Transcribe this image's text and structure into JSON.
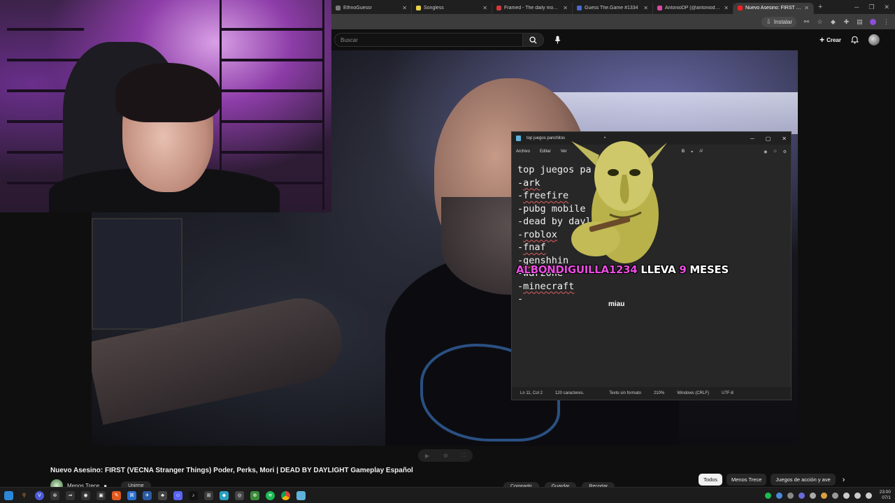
{
  "browser": {
    "tabs": [
      {
        "label": "EthnoGuessr",
        "color": "#7a7a7a",
        "active": false
      },
      {
        "label": "Songless",
        "color": "#e8d14a",
        "active": false
      },
      {
        "label": "Framed - The daily movie gu",
        "color": "#d03a3a",
        "active": false
      },
      {
        "label": "Guess The.Game #1334",
        "color": "#4a6ad0",
        "active": false
      },
      {
        "label": "AntonioDP (@antoniodesanti",
        "color": "#d94aa0",
        "active": false
      },
      {
        "label": "Nuevo Asesino: FIRST (VECNA",
        "color": "#ff2020",
        "active": true
      }
    ],
    "install_label": "Instalar"
  },
  "youtube": {
    "search_placeholder": "Buscar",
    "create_label": "Crear",
    "video_title": "Nuevo Asesino: FIRST (VECNA Stranger Things) Poder, Perks, Mori | DEAD BY DAYLIGHT Gameplay Español",
    "channel_name": "Menos Trece",
    "join_label": "Unirme",
    "chips": [
      "Todos",
      "Menos Trece",
      "Juegos de acción y ave"
    ],
    "action_labels": [
      "Compartir",
      "Guardar",
      "Recortar"
    ]
  },
  "notepad": {
    "tab_title": "top juegos panchitos",
    "menu": [
      "Archivo",
      "Editar",
      "Ver"
    ],
    "lines": [
      {
        "text": "top juegos pa",
        "underline": false
      },
      {
        "text": "-ark",
        "underline": true
      },
      {
        "text": "-freefire",
        "underline": true
      },
      {
        "text": "-pubg mobile",
        "underline": false
      },
      {
        "text": "-dead by dayli",
        "underline": false
      },
      {
        "text": "-roblox",
        "underline": true
      },
      {
        "text": "-fnaf",
        "underline": true
      },
      {
        "text": "-genshhin",
        "underline": true
      },
      {
        "text": "-warzone",
        "underline": false
      },
      {
        "text": "-minecraft",
        "underline": true
      },
      {
        "text": "-",
        "underline": false
      }
    ],
    "status": {
      "position": "Ln 11, Col 2",
      "chars": "120 caracteres.",
      "format": "Texto sin formato",
      "zoom": "210%",
      "eol": "Windows (CRLF)",
      "encoding": "UTF-8"
    }
  },
  "overlay": {
    "sub_name": "ALBONDIGUILLA1234",
    "sub_mid": "LLEVA",
    "sub_num": "9",
    "sub_end": "MESES",
    "message": "miau"
  },
  "taskbar": {
    "time": "23:00",
    "date": "07/1"
  }
}
